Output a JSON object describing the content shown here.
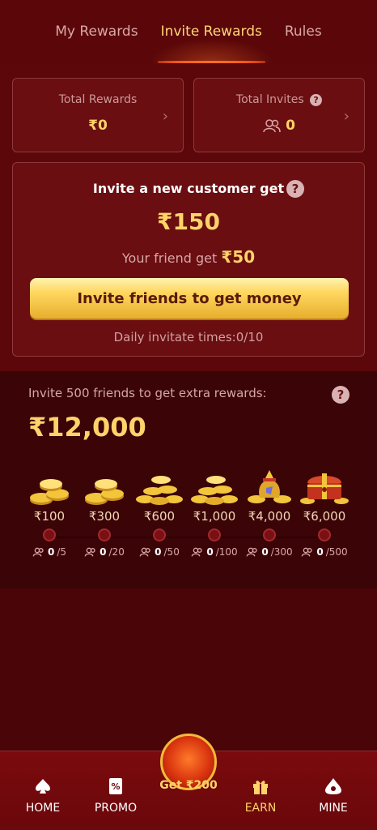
{
  "tabs": [
    {
      "label": "My Rewards",
      "active": false
    },
    {
      "label": "Invite Rewards",
      "active": true
    },
    {
      "label": "Rules",
      "active": false
    }
  ],
  "stats": {
    "total_rewards_title": "Total Rewards",
    "total_rewards_value": "₹0",
    "total_invites_title": "Total Invites",
    "total_invites_value": "0",
    "qmark": "?"
  },
  "invite": {
    "heading": "Invite a new customer get",
    "amount": "₹150",
    "friend_prefix": "Your friend get",
    "friend_amount": "₹50",
    "button_label": "Invite friends to get money",
    "daily_text": "Daily invitate times:0/10"
  },
  "extra": {
    "title": "Invite 500 friends to get extra rewards:",
    "amount": "₹12,000",
    "tiers": [
      {
        "amount": "₹100",
        "progress": "0",
        "target": "/5",
        "icon": "coin-stack-icon"
      },
      {
        "amount": "₹300",
        "progress": "0",
        "target": "/20",
        "icon": "coin-stack-icon"
      },
      {
        "amount": "₹600",
        "progress": "0",
        "target": "/50",
        "icon": "coin-pile-icon"
      },
      {
        "amount": "₹1,000",
        "progress": "0",
        "target": "/100",
        "icon": "coin-pile-icon"
      },
      {
        "amount": "₹4,000",
        "progress": "0",
        "target": "/300",
        "icon": "coin-bag-icon"
      },
      {
        "amount": "₹6,000",
        "progress": "0",
        "target": "/500",
        "icon": "treasure-chest-icon"
      }
    ]
  },
  "nav": {
    "home": "HOME",
    "promo": "PROMO",
    "center": "Get ₹200",
    "earn": "EARN",
    "mine": "MINE"
  },
  "colors": {
    "gold": "#ffd36a",
    "bg": "#4a0508",
    "card": "#6a0e11"
  }
}
